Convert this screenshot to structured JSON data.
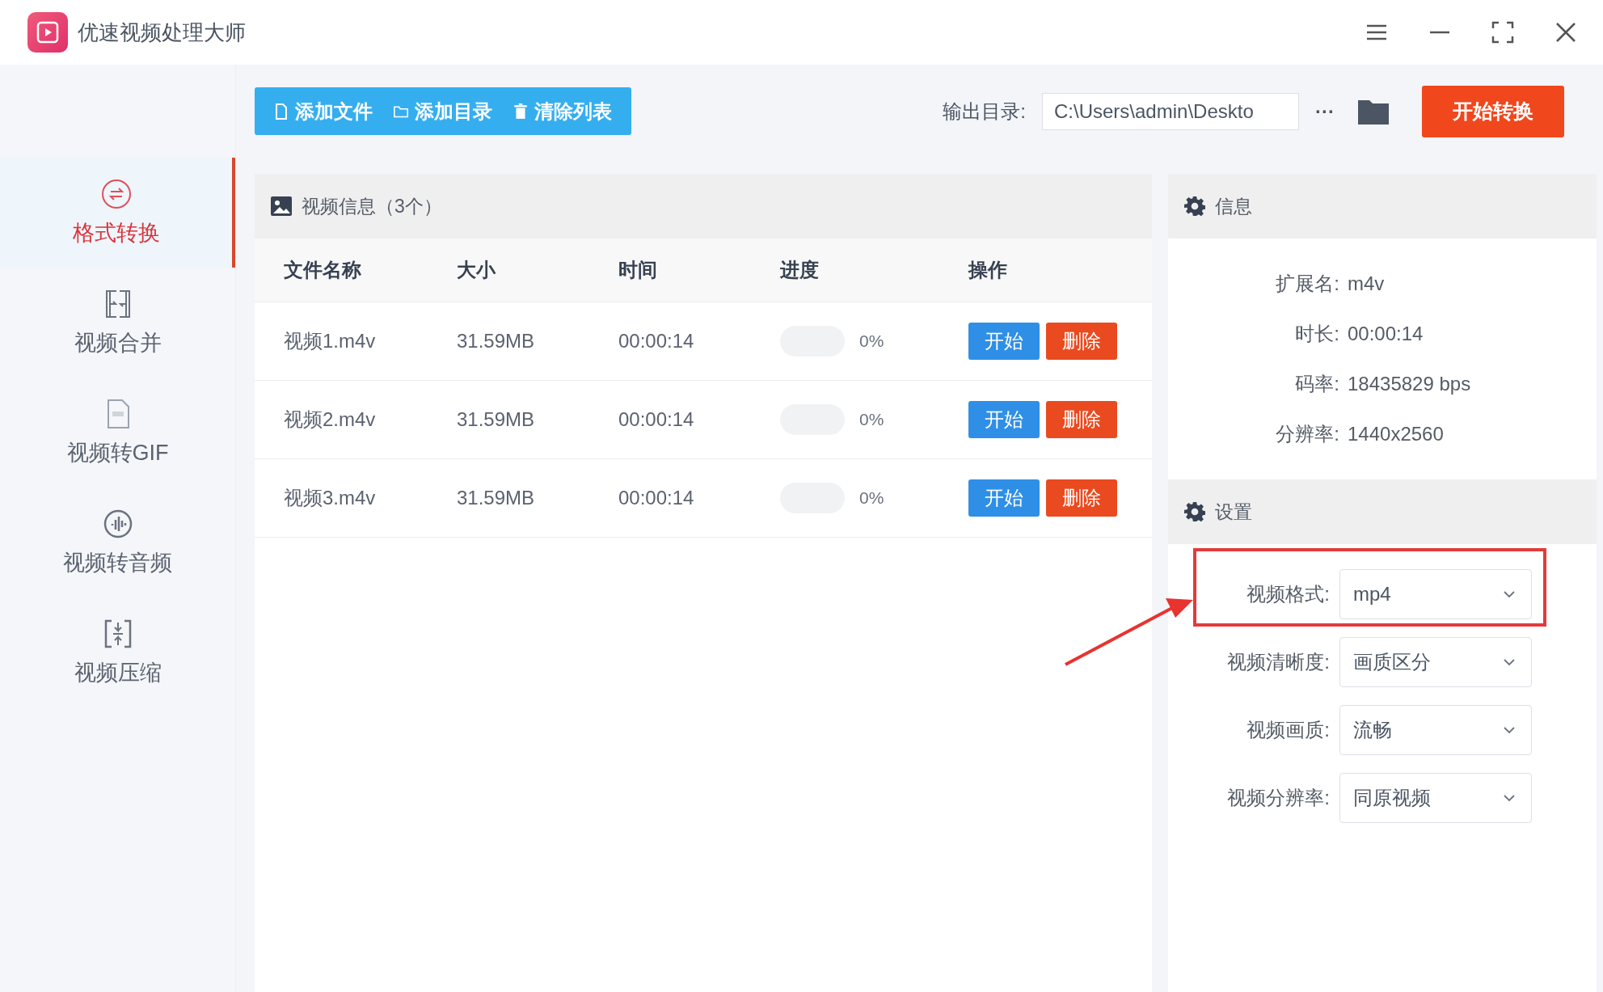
{
  "window": {
    "title": "优速视频处理大师"
  },
  "toolbar": {
    "buttons": [
      {
        "kind": "file",
        "label": "添加文件"
      },
      {
        "kind": "folder",
        "label": "添加目录"
      },
      {
        "kind": "trash",
        "label": "清除列表"
      }
    ],
    "output_label": "输出目录:",
    "output_path": "C:\\Users\\admin\\Deskto",
    "more": "···",
    "start": "开始转换"
  },
  "sidebar": {
    "items": [
      {
        "kind": "convert",
        "label": "格式转换",
        "selected": true
      },
      {
        "kind": "merge",
        "label": "视频合并",
        "selected": false
      },
      {
        "kind": "gif",
        "label": "视频转GIF",
        "selected": false
      },
      {
        "kind": "audio",
        "label": "视频转音频",
        "selected": false
      },
      {
        "kind": "compress",
        "label": "视频压缩",
        "selected": false
      }
    ]
  },
  "table": {
    "title": "视频信息（3个）",
    "columns": [
      "文件名称",
      "大小",
      "时间",
      "进度",
      "操作"
    ],
    "rows": [
      {
        "name": "视频1.m4v",
        "size": "31.59MB",
        "time": "00:00:14",
        "level": 0,
        "progress": "0%",
        "start": "开始",
        "delete": "删除"
      },
      {
        "name": "视频2.m4v",
        "size": "31.59MB",
        "time": "00:00:14",
        "level": 0,
        "progress": "0%",
        "start": "开始",
        "delete": "删除"
      },
      {
        "name": "视频3.m4v",
        "size": "31.59MB",
        "time": "00:00:14",
        "level": 0,
        "progress": "0%",
        "start": "开始",
        "delete": "删除"
      }
    ]
  },
  "info": {
    "title": "信息",
    "fields": [
      {
        "label": "扩展名:",
        "value": "m4v"
      },
      {
        "label": "时长:",
        "value": "00:00:14"
      },
      {
        "label": "码率:",
        "value": "18435829 bps"
      },
      {
        "label": "分辨率:",
        "value": "1440x2560"
      }
    ]
  },
  "settings": {
    "title": "设置",
    "fields": [
      {
        "label": "视频格式:",
        "value": "mp4"
      },
      {
        "label": "视频清晰度:",
        "value": "画质区分"
      },
      {
        "label": "视频画质:",
        "value": "流畅"
      },
      {
        "label": "视频分辨率:",
        "value": "同原视频"
      }
    ]
  }
}
